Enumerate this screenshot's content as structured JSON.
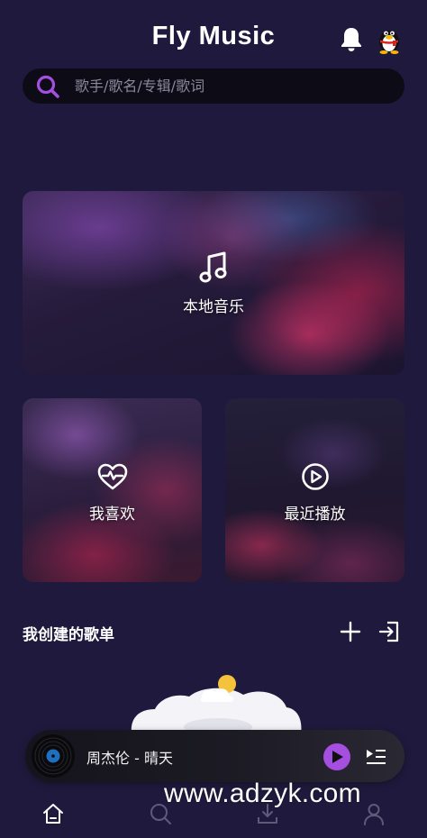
{
  "header": {
    "title": "Fly Music",
    "bell_icon": "bell-icon",
    "avatar_icon": "qq-penguin-avatar"
  },
  "search": {
    "placeholder": "歌手/歌名/专辑/歌词",
    "icon": "search-icon"
  },
  "cards": {
    "local": {
      "label": "本地音乐",
      "icon": "music-note-icon"
    },
    "favorites": {
      "label": "我喜欢",
      "icon": "heart-pulse-icon"
    },
    "recent": {
      "label": "最近播放",
      "icon": "play-circle-icon"
    }
  },
  "playlists": {
    "title": "我创建的歌单",
    "add_icon": "plus-icon",
    "import_icon": "import-icon"
  },
  "player": {
    "track": "周杰伦 - 晴天",
    "accent": "#a54fe0",
    "disc_icon": "vinyl-disc-icon",
    "play_icon": "play-icon",
    "queue_icon": "playlist-icon"
  },
  "bottom_nav": [
    "home-icon",
    "search-icon",
    "download-icon",
    "user-icon"
  ],
  "watermark": "www.adzyk.com",
  "colors": {
    "background": "#1f1a3d",
    "search_bg": "#0c0b16",
    "accent": "#a54fe0"
  }
}
